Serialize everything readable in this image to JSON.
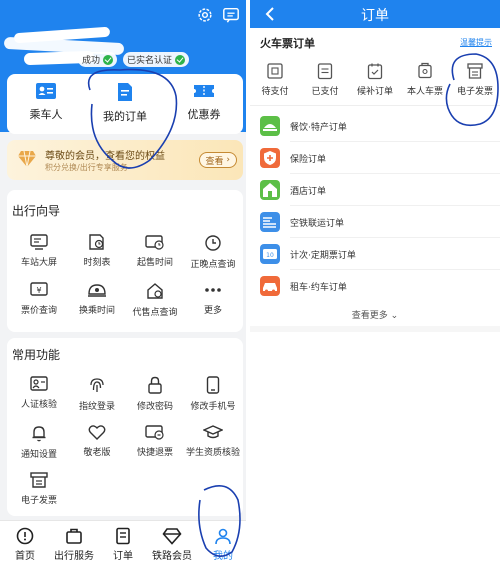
{
  "left": {
    "badges": [
      "成功",
      "已实名认证"
    ],
    "quick_items": [
      {
        "label": "乘车人",
        "icon": "passenger-card-icon"
      },
      {
        "label": "我的订单",
        "icon": "order-doc-icon"
      },
      {
        "label": "优惠券",
        "icon": "coupon-icon"
      }
    ],
    "member": {
      "title": "尊敬的会员，查看您的权益",
      "sub": "积分兑换/出行专享服务",
      "button": "查看"
    },
    "travel_guide": {
      "title": "出行向导",
      "items": [
        {
          "label": "车站大屏",
          "icon": "screen-icon"
        },
        {
          "label": "时刻表",
          "icon": "timetable-icon"
        },
        {
          "label": "起售时间",
          "icon": "ticket-clock-icon"
        },
        {
          "label": "正晚点查询",
          "icon": "clock-icon"
        },
        {
          "label": "票价查询",
          "icon": "price-icon"
        },
        {
          "label": "换乘时间",
          "icon": "transfer-icon"
        },
        {
          "label": "代售点查询",
          "icon": "agency-icon"
        },
        {
          "label": "更多",
          "icon": "more-dots-icon"
        }
      ]
    },
    "common": {
      "title": "常用功能",
      "items": [
        {
          "label": "人证核验",
          "icon": "id-verify-icon"
        },
        {
          "label": "指纹登录",
          "icon": "fingerprint-icon"
        },
        {
          "label": "修改密码",
          "icon": "lock-icon"
        },
        {
          "label": "修改手机号",
          "icon": "phone-icon"
        },
        {
          "label": "通知设置",
          "icon": "bell-icon"
        },
        {
          "label": "敬老版",
          "icon": "heart-icon"
        },
        {
          "label": "快捷退票",
          "icon": "refund-icon"
        },
        {
          "label": "学生资质核验",
          "icon": "graduation-cap-icon"
        },
        {
          "label": "电子发票",
          "icon": "invoice-icon"
        }
      ]
    },
    "tabs": [
      {
        "label": "首页",
        "icon": "home-icon"
      },
      {
        "label": "出行服务",
        "icon": "travel-bag-icon"
      },
      {
        "label": "订单",
        "icon": "order-icon"
      },
      {
        "label": "铁路会员",
        "icon": "diamond-icon"
      },
      {
        "label": "我的",
        "icon": "user-icon",
        "active": true
      }
    ],
    "accent": "#1f83ee"
  },
  "right": {
    "nav_title": "订单",
    "ticket_title": "火车票订单",
    "tip_link": "温馨提示",
    "statuses": [
      {
        "label": "待支付",
        "icon": "pending-pay-icon"
      },
      {
        "label": "已支付",
        "icon": "paid-icon"
      },
      {
        "label": "候补订单",
        "icon": "waitlist-icon"
      },
      {
        "label": "本人车票",
        "icon": "my-ticket-icon"
      },
      {
        "label": "电子发票",
        "icon": "invoice-icon"
      }
    ],
    "orders": [
      {
        "label": "餐饮·特产订单",
        "color": "#5cbf47",
        "icon": "food-icon"
      },
      {
        "label": "保险订单",
        "color": "#f06a3a",
        "icon": "shield-icon"
      },
      {
        "label": "酒店订单",
        "color": "#5cbf47",
        "icon": "hotel-icon"
      },
      {
        "label": "空铁联运订单",
        "color": "#3d8fe8",
        "icon": "air-rail-icon"
      },
      {
        "label": "计次·定期票订单",
        "color": "#3d8fe8",
        "icon": "count-ticket-icon"
      },
      {
        "label": "租车·约车订单",
        "color": "#f06a3a",
        "icon": "car-icon"
      }
    ],
    "more": "查看更多"
  }
}
